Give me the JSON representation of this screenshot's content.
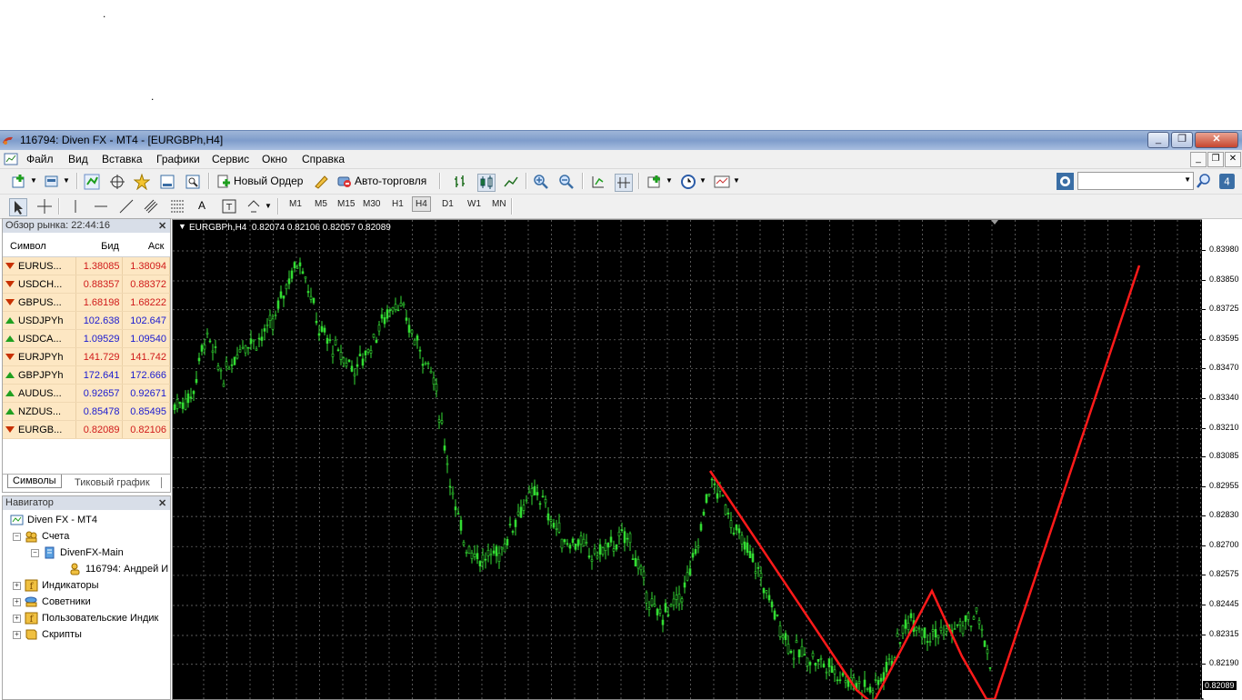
{
  "window": {
    "title": "116794: Diven FX - MT4 - [EURGBPh,H4]",
    "buttons": [
      "_",
      "❐",
      "✕"
    ]
  },
  "menu": {
    "items": [
      "Файл",
      "Вид",
      "Вставка",
      "Графики",
      "Сервис",
      "Окно",
      "Справка"
    ]
  },
  "toolbar": {
    "new_order": "Новый Ордер",
    "autotrading": "Авто-торговля"
  },
  "timeframes": [
    "M1",
    "M5",
    "M15",
    "M30",
    "H1",
    "H4",
    "D1",
    "W1",
    "MN"
  ],
  "active_timeframe": "H4",
  "market_watch": {
    "title": "Обзор рынка: 22:44:16",
    "columns": [
      "Символ",
      "Бид",
      "Аск"
    ],
    "rows": [
      {
        "symbol": "EURUS...",
        "bid": "1.38085",
        "ask": "1.38094",
        "dir": "down"
      },
      {
        "symbol": "USDCH...",
        "bid": "0.88357",
        "ask": "0.88372",
        "dir": "down"
      },
      {
        "symbol": "GBPUS...",
        "bid": "1.68198",
        "ask": "1.68222",
        "dir": "down"
      },
      {
        "symbol": "USDJPYh",
        "bid": "102.638",
        "ask": "102.647",
        "dir": "up"
      },
      {
        "symbol": "USDCA...",
        "bid": "1.09529",
        "ask": "1.09540",
        "dir": "up"
      },
      {
        "symbol": "EURJPYh",
        "bid": "141.729",
        "ask": "141.742",
        "dir": "down"
      },
      {
        "symbol": "GBPJPYh",
        "bid": "172.641",
        "ask": "172.666",
        "dir": "up"
      },
      {
        "symbol": "AUDUS...",
        "bid": "0.92657",
        "ask": "0.92671",
        "dir": "up"
      },
      {
        "symbol": "NZDUS...",
        "bid": "0.85478",
        "ask": "0.85495",
        "dir": "up"
      },
      {
        "symbol": "EURGB...",
        "bid": "0.82089",
        "ask": "0.82106",
        "dir": "down"
      }
    ],
    "tabs": [
      "Символы",
      "Тиковый график"
    ]
  },
  "navigator": {
    "title": "Навигатор",
    "items": [
      {
        "label": "Diven FX - MT4",
        "level": 0
      },
      {
        "label": "Счета",
        "level": 1
      },
      {
        "label": "DivenFX-Main",
        "level": 2
      },
      {
        "label": "116794: Андрей И",
        "level": 3
      },
      {
        "label": "Индикаторы",
        "level": 1
      },
      {
        "label": "Советники",
        "level": 1
      },
      {
        "label": "Пользовательские Индик",
        "level": 1
      },
      {
        "label": "Скрипты",
        "level": 1
      }
    ]
  },
  "chart": {
    "header": "EURGBPh,H4  0.82074 0.82106 0.82057 0.82089",
    "price_levels": [
      "0.83980",
      "0.83850",
      "0.83725",
      "0.83595",
      "0.83470",
      "0.83340",
      "0.83210",
      "0.83085",
      "0.82955",
      "0.82830",
      "0.82700",
      "0.82575",
      "0.82445",
      "0.82315",
      "0.82190"
    ],
    "current_price": "0.82089",
    "candle_color": "#33dd33",
    "zigzag_color": "#ff1a1a",
    "background": "#000000"
  }
}
